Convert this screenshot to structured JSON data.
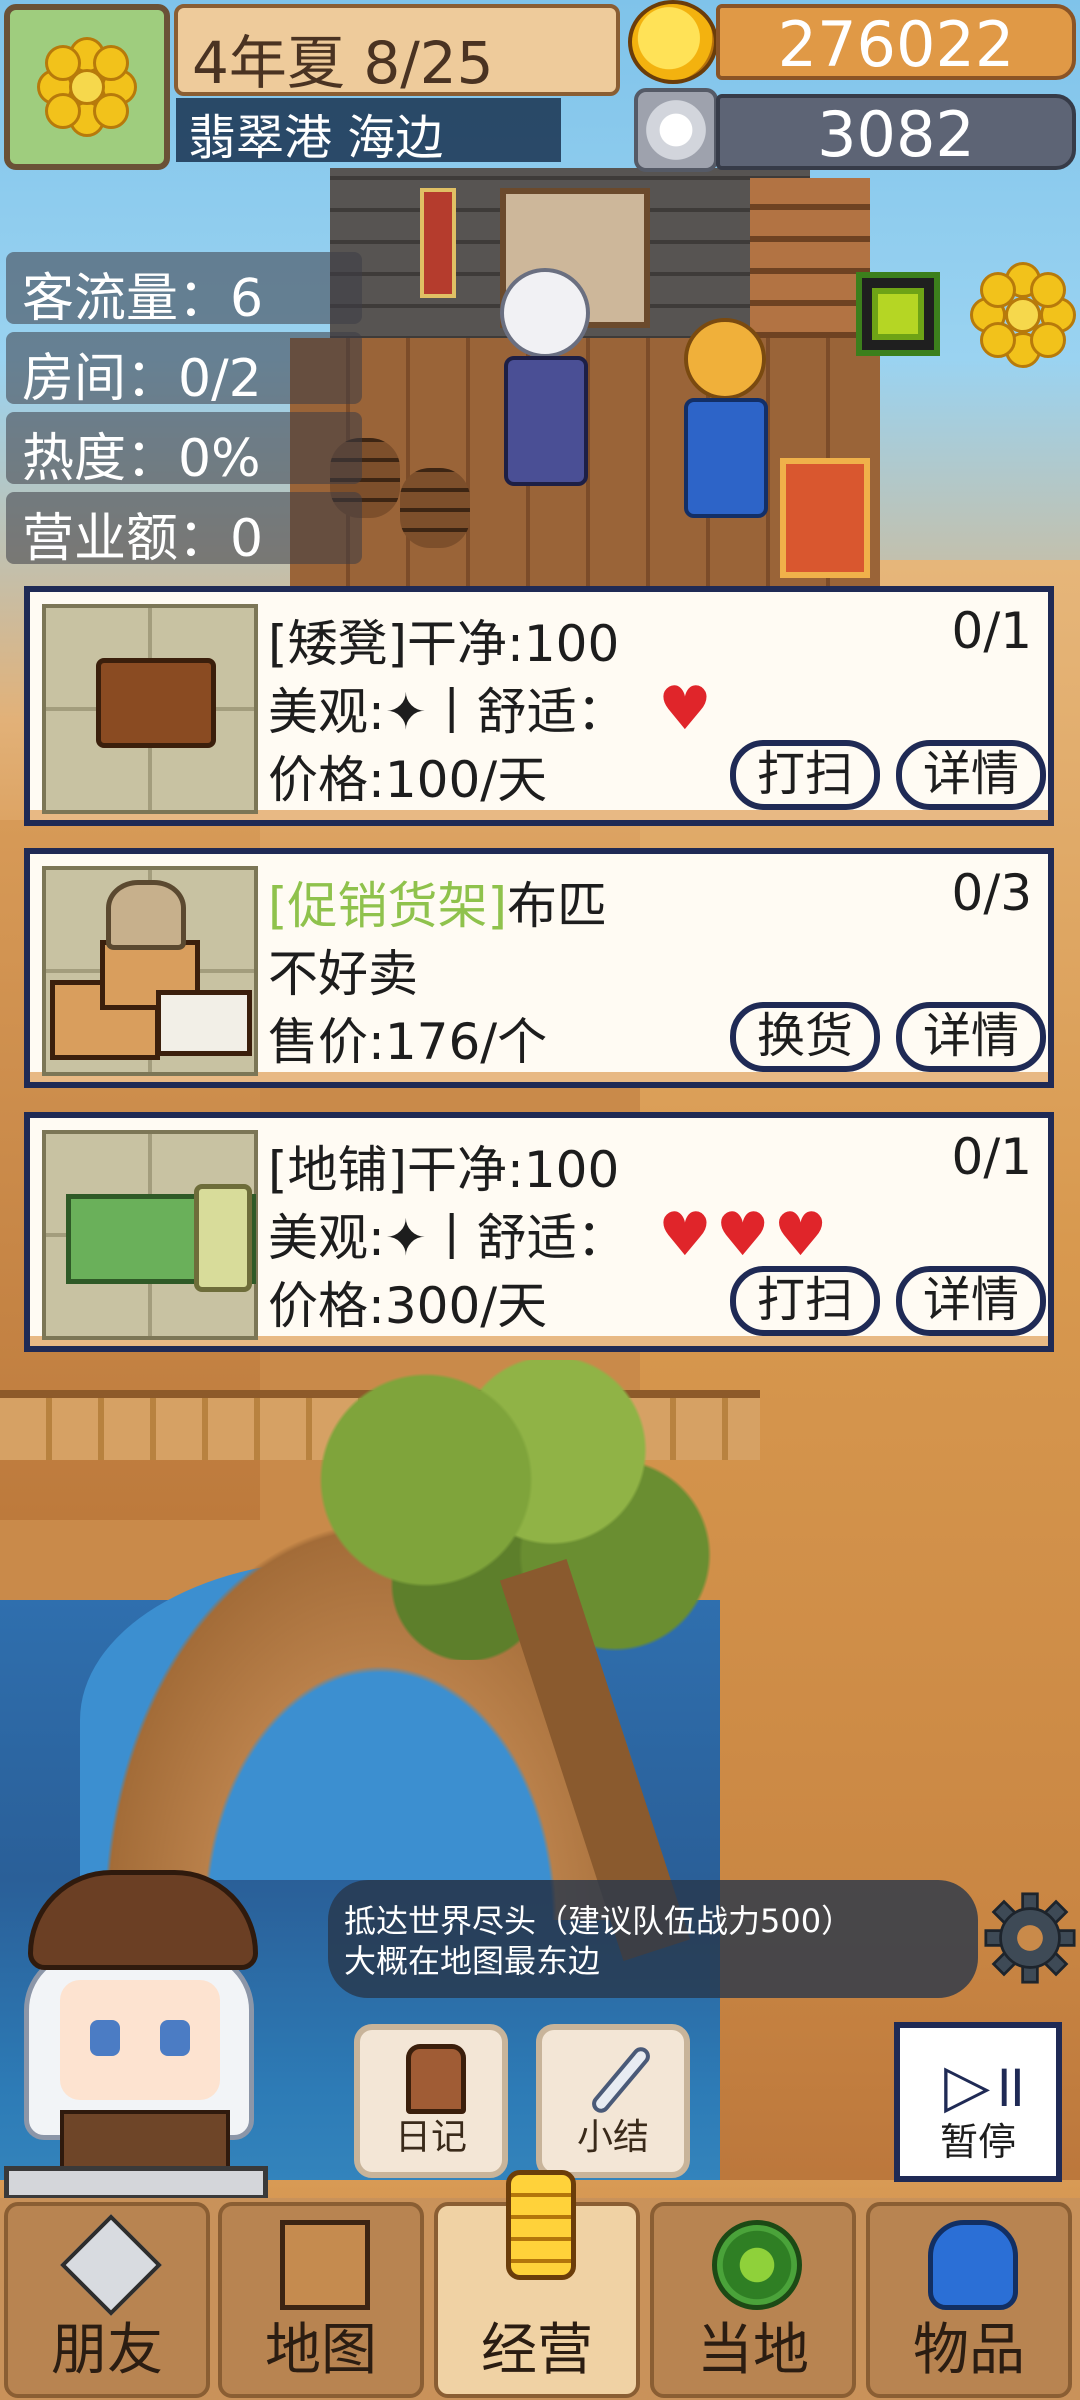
{
  "hud": {
    "date": "4年夏 8/25",
    "location": "翡翠港 海边",
    "gold": "276022",
    "silver": "3082"
  },
  "stats": [
    {
      "label": "客流量：6"
    },
    {
      "label": "房间：0/2"
    },
    {
      "label": "热度：0%"
    },
    {
      "label": "营业额：0"
    }
  ],
  "cards": [
    {
      "title": "[矮凳]干净:100",
      "line2": "美观:✦丨舒适：",
      "hearts": "♥",
      "line3": "价格:100/天",
      "count": "0/1",
      "btn_a": "打扫",
      "btn_b": "详情"
    },
    {
      "promo_tag": "[促销货架]",
      "title": "布匹",
      "line2": "不好卖",
      "line3": "售价:176/个",
      "count": "0/3",
      "btn_a": "换货",
      "btn_b": "详情"
    },
    {
      "title": "[地铺]干净:100",
      "line2": "美观:✦丨舒适：",
      "hearts": "♥♥♥",
      "line3": "价格:300/天",
      "count": "0/1",
      "btn_a": "打扫",
      "btn_b": "详情"
    }
  ],
  "quest": {
    "line1": "抵达世界尽头（建议队伍战力500）",
    "line2": "大概在地图最东边"
  },
  "actions": {
    "diary": "日记",
    "summary": "小结",
    "pause": "暂停",
    "pause_icon": "▷॥"
  },
  "nav": {
    "friends": "朋友",
    "map": "地图",
    "business": "经营",
    "local": "当地",
    "items": "物品"
  },
  "colors": {
    "card_border": "#1f2a55",
    "heart": "#e0252a",
    "promo": "#8fc24c",
    "gold_box": "#e09946",
    "silver_box": "#5d6475"
  }
}
